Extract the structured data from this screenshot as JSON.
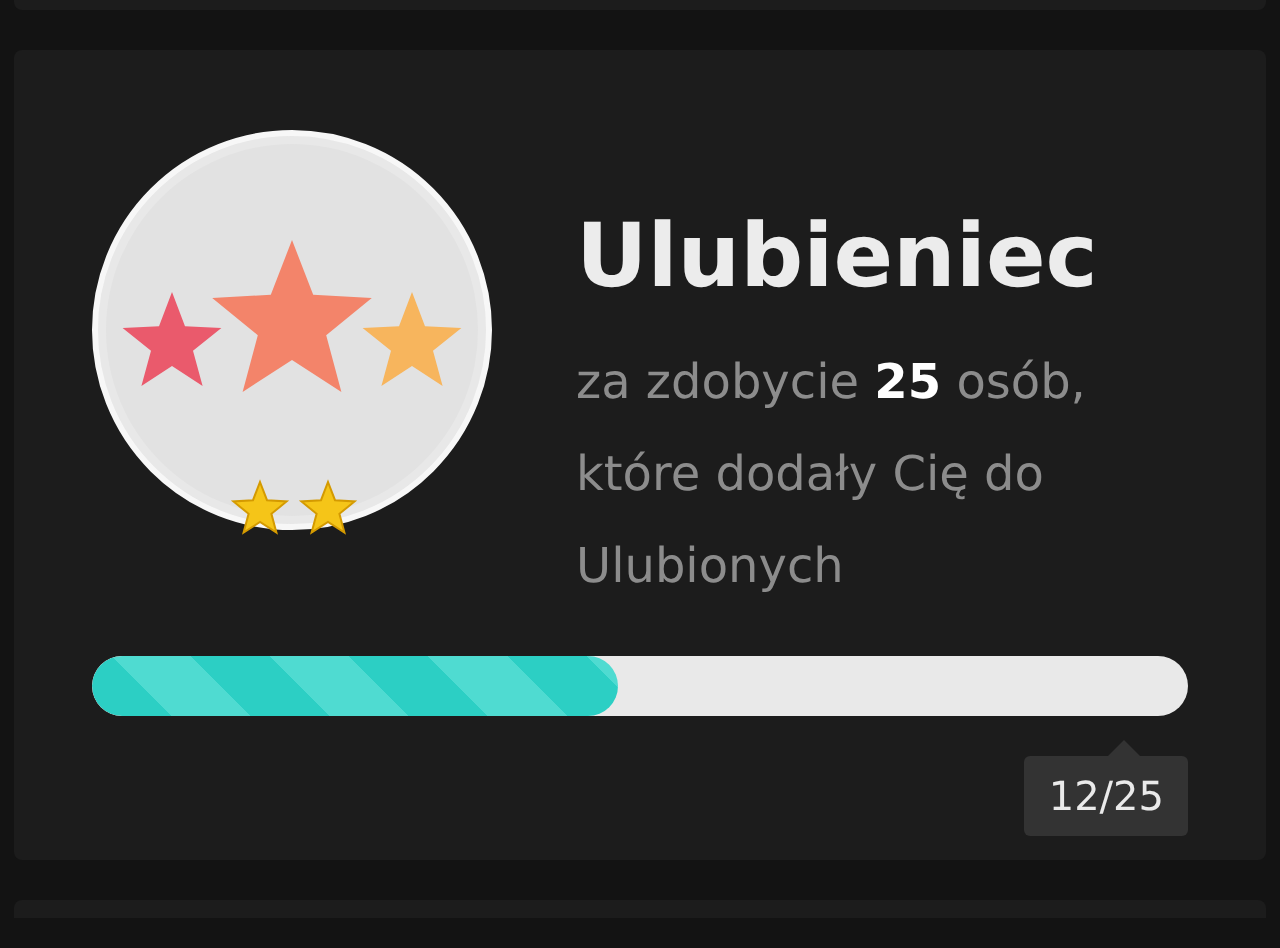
{
  "achievement": {
    "title": "Ulubieniec",
    "description": "za zdobycie **25** osób, które dodały Cię do Ulubionych",
    "progress": {
      "level": 0.48,
      "reading": "12/25"
    }
  }
}
